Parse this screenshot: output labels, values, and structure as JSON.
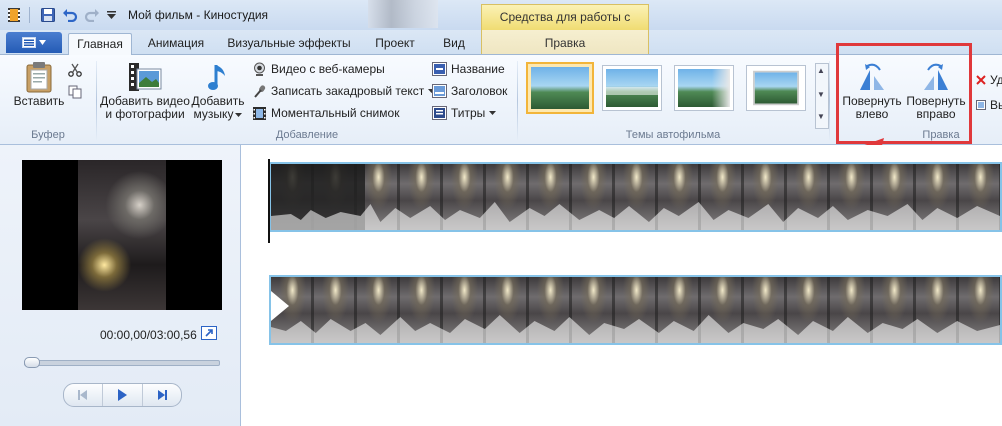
{
  "window": {
    "title": "Мой фильм - Киностудия",
    "context_header": "Средства для работы с видео"
  },
  "tabs": [
    {
      "label": "Главная"
    },
    {
      "label": "Анимация"
    },
    {
      "label": "Визуальные эффекты"
    },
    {
      "label": "Проект"
    },
    {
      "label": "Вид"
    }
  ],
  "context_tab": {
    "label": "Правка"
  },
  "ribbon": {
    "clipboard": {
      "paste_label": "Вставить",
      "group_label": "Буфер"
    },
    "add": {
      "add_video_line1": "Добавить видео",
      "add_video_line2": "и фотографии",
      "add_music_line1": "Добавить",
      "add_music_line2": "музыку",
      "webcam_label": "Видео с веб-камеры",
      "narration_label": "Записать закадровый текст",
      "snapshot_label": "Моментальный снимок",
      "title_label": "Название",
      "caption_label": "Заголовок",
      "credits_label": "Титры",
      "group_label": "Добавление"
    },
    "themes": {
      "group_label": "Темы автофильма"
    },
    "edit": {
      "rotate_left_line1": "Повернуть",
      "rotate_left_line2": "влево",
      "rotate_right_line1": "Повернуть",
      "rotate_right_line2": "вправо",
      "group_label": "Правка",
      "remove_label_partial": "Уда",
      "cut_label_partial": "Вы"
    }
  },
  "preview": {
    "timecode": "00:00,00/03:00,56",
    "seek_progress": 0.0
  },
  "colors": {
    "accent": "#2c63c5",
    "highlight_box": "#e0383b",
    "context_tab": "#f0dc72",
    "clip_border": "#86c3e8"
  }
}
